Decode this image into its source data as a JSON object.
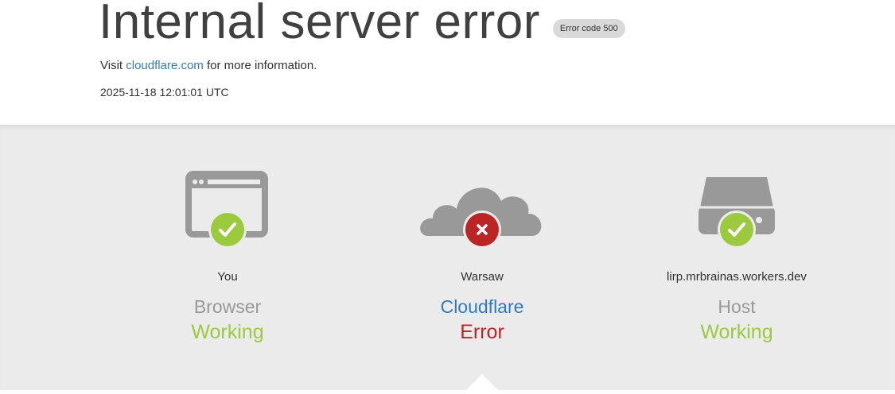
{
  "header": {
    "title": "Internal server error",
    "error_badge": "Error code 500",
    "visit_prefix": "Visit ",
    "visit_link": "cloudflare.com",
    "visit_suffix": " for more information.",
    "timestamp": "2025-11-18 12:01:01 UTC"
  },
  "nodes": [
    {
      "icon": "browser-window-icon",
      "status_icon": "check-icon",
      "location": "You",
      "kind": "Browser",
      "state": "Working"
    },
    {
      "icon": "cloud-icon",
      "status_icon": "x-icon",
      "location": "Warsaw",
      "kind": "Cloudflare",
      "state": "Error"
    },
    {
      "icon": "server-drive-icon",
      "status_icon": "check-icon",
      "location": "lirp.mrbrainas.workers.dev",
      "kind": "Host",
      "state": "Working"
    }
  ],
  "colors": {
    "ok": "#9bca3e",
    "error": "#bd2426",
    "link": "#2f7bbf",
    "icon_gray": "#999999"
  }
}
